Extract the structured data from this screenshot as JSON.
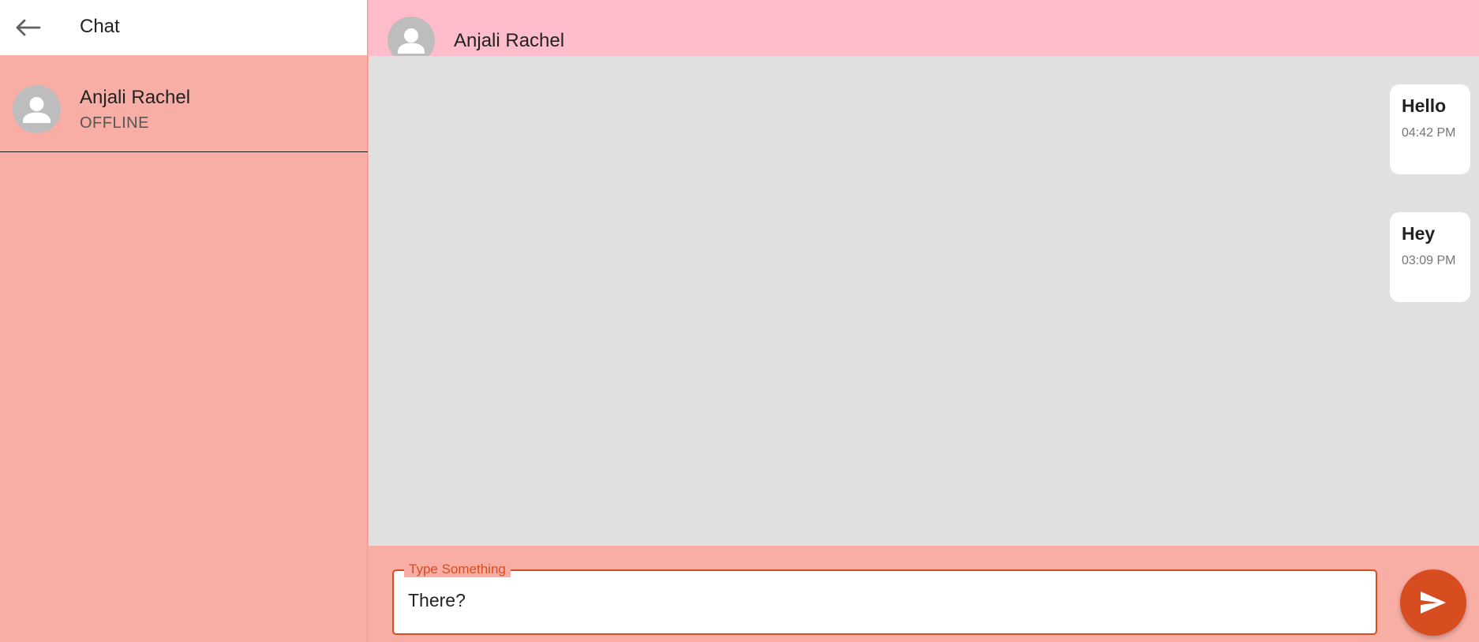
{
  "sidebar": {
    "title": "Chat",
    "back_icon": "arrow-left-icon",
    "contacts": [
      {
        "name": "Anjali Rachel",
        "status": "OFFLINE",
        "avatar_icon": "person-icon"
      }
    ]
  },
  "chat": {
    "header": {
      "name": "Anjali Rachel",
      "avatar_icon": "person-icon"
    },
    "messages": [
      {
        "text": "Hello",
        "time": "04:42 PM"
      },
      {
        "text": "Hey",
        "time": "03:09 PM"
      }
    ],
    "composer": {
      "label": "Type Something",
      "value": "There?",
      "send_icon": "send-icon"
    }
  },
  "colors": {
    "sidebar_bg": "#f8aea5",
    "header_bg": "#ffbccb",
    "messages_bg": "#e0e0e0",
    "accent": "#d84d20",
    "avatar_bg": "#bdbdbd"
  }
}
